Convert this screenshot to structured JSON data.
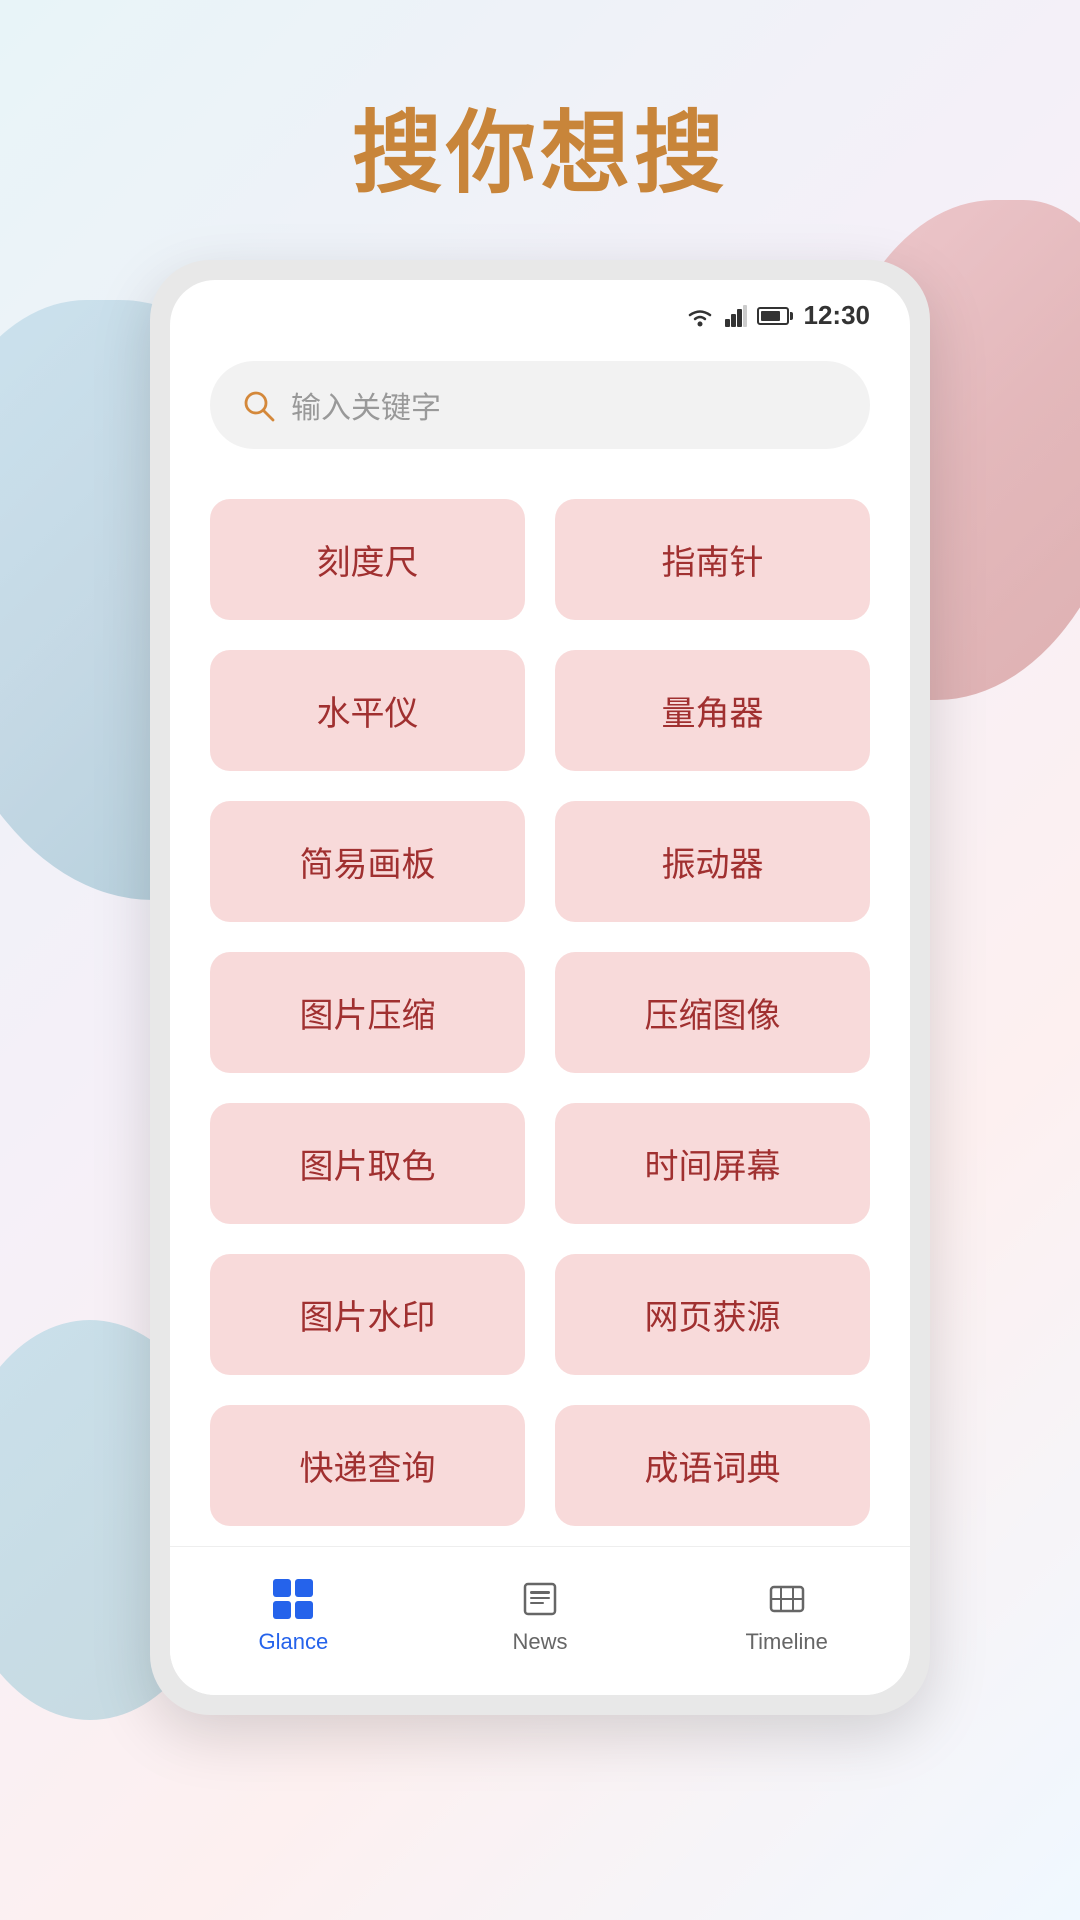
{
  "page": {
    "title": "搜你想搜",
    "background_colors": {
      "blob1": "#b8d8e8",
      "blob2": "#e8a0a0",
      "blob3": "#88c8d8"
    }
  },
  "status_bar": {
    "time": "12:30"
  },
  "search": {
    "placeholder": "输入关键字"
  },
  "tools": [
    {
      "id": "ruler",
      "label": "刻度尺"
    },
    {
      "id": "compass",
      "label": "指南针"
    },
    {
      "id": "level",
      "label": "水平仪"
    },
    {
      "id": "protractor",
      "label": "量角器"
    },
    {
      "id": "sketchpad",
      "label": "简易画板"
    },
    {
      "id": "vibrator",
      "label": "振动器"
    },
    {
      "id": "img-compress",
      "label": "图片压缩"
    },
    {
      "id": "img-compress2",
      "label": "压缩图像"
    },
    {
      "id": "color-picker",
      "label": "图片取色"
    },
    {
      "id": "time-screen",
      "label": "时间屏幕"
    },
    {
      "id": "watermark",
      "label": "图片水印"
    },
    {
      "id": "web-source",
      "label": "网页获源"
    },
    {
      "id": "express",
      "label": "快递查询"
    },
    {
      "id": "idiom",
      "label": "成语词典"
    }
  ],
  "bottom_nav": {
    "items": [
      {
        "id": "glance",
        "label": "Glance",
        "active": true
      },
      {
        "id": "news",
        "label": "News",
        "active": false
      },
      {
        "id": "timeline",
        "label": "Timeline",
        "active": false
      }
    ]
  }
}
